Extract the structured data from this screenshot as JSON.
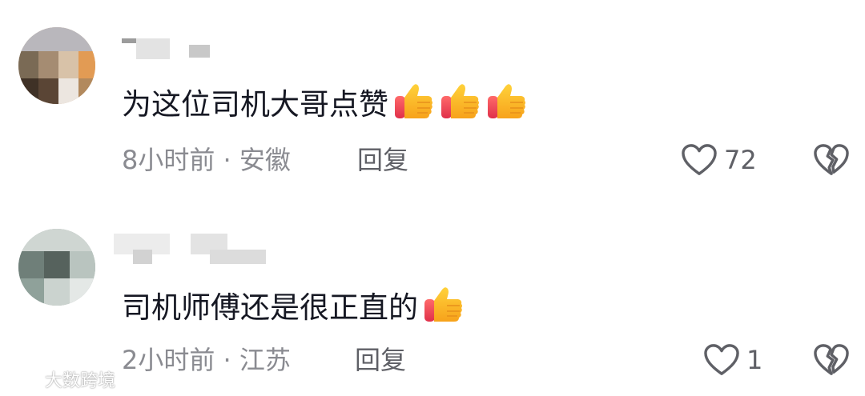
{
  "comments": [
    {
      "text": "为这位司机大哥点赞",
      "emoji_count": 3,
      "time": "8小时前",
      "separator": "·",
      "location": "安徽",
      "reply_label": "回复",
      "likes": "72"
    },
    {
      "text": "司机师傅还是很正直的",
      "emoji_count": 1,
      "time": "2小时前",
      "separator": "·",
      "location": "江苏",
      "reply_label": "回复",
      "likes": "1"
    }
  ],
  "watermark": {
    "text": "大数跨境"
  },
  "icons": {
    "emoji": "thumbs-up-emoji",
    "like": "heart-outline-icon",
    "dislike": "broken-heart-icon"
  },
  "colors": {
    "text": "#161823",
    "meta": "#8a8b91",
    "icon": "#5f6066"
  }
}
